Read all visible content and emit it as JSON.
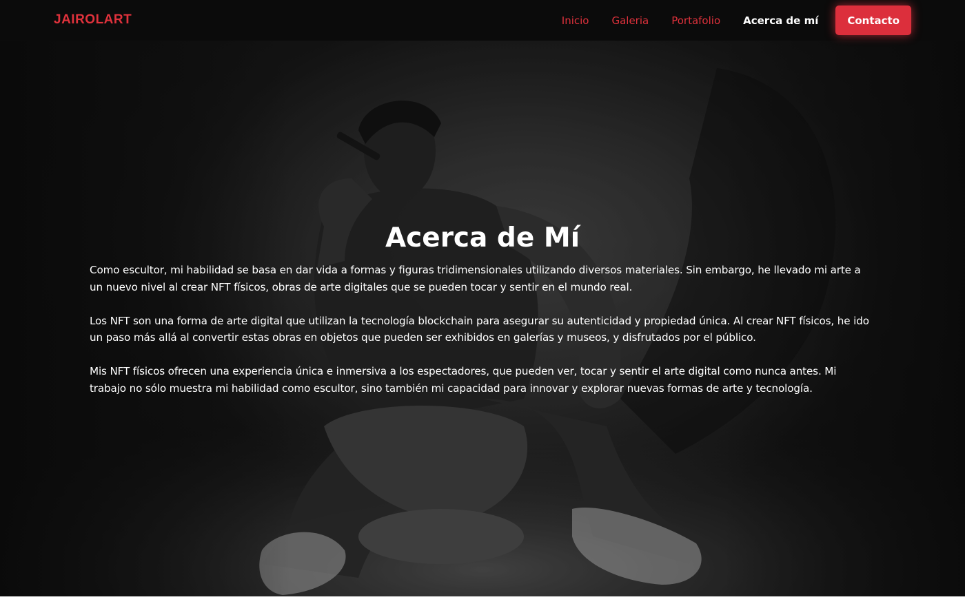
{
  "navbar": {
    "brand": "JAIROLART",
    "links": [
      {
        "label": "Inicio",
        "active": false
      },
      {
        "label": "Galeria",
        "active": false
      },
      {
        "label": "Portafolio",
        "active": false
      },
      {
        "label": "Acerca de mí",
        "active": true
      }
    ],
    "cta_label": "Contacto"
  },
  "hero": {
    "title": "Acerca de Mí",
    "paragraphs": [
      "Como escultor, mi habilidad se basa en dar vida a formas y figuras tridimensionales utilizando diversos materiales. Sin embargo, he llevado mi arte a un nuevo nivel al crear NFT físicos, obras de arte digitales que se pueden tocar y sentir en el mundo real.",
      "Los NFT son una forma de arte digital que utilizan la tecnología blockchain para asegurar su autenticidad y propiedad única. Al crear NFT físicos, he ido un paso más allá al convertir estas obras en objetos que pueden ser exhibidos en galerías y museos, y disfrutados por el público.",
      "Mis NFT físicos ofrecen una experiencia única e inmersiva a los espectadores, que pueden ver, tocar y sentir el arte digital como nunca antes. Mi trabajo no sólo muestra mi habilidad como escultor, sino también mi capacidad para innovar y explorar nuevas formas de arte y tecnología."
    ]
  },
  "colors": {
    "accent": "#dc2f3c",
    "navbar_bg": "#0b0b0b",
    "hero_text": "#ffffff"
  }
}
